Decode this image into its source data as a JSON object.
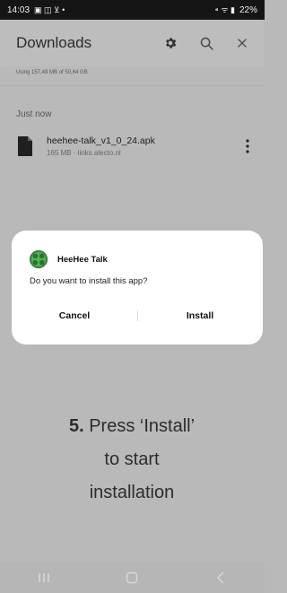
{
  "status_bar": {
    "time": "14:03",
    "left_glyphs": "▣ ◫ ⊻ •",
    "right_glyphs": "⁌ ᯤ ▮",
    "battery": "22%"
  },
  "header": {
    "title": "Downloads"
  },
  "storage": {
    "text": "Using 157,49 MB of 50,64 GB"
  },
  "downloads": {
    "section_label": "Just now",
    "item": {
      "name": "heehee-talk_v1_0_24.apk",
      "meta": "165 MB · links.alecto.nl"
    }
  },
  "dialog": {
    "app_name": "HeeHee Talk",
    "question": "Do you want to install this app?",
    "cancel_label": "Cancel",
    "install_label": "Install"
  },
  "instruction": {
    "step": "5.",
    "line1": "Press ‘Install’",
    "line2": "to start",
    "line3": "installation"
  },
  "navigation": {
    "items": [
      "recent-apps",
      "home",
      "back"
    ]
  },
  "colors": {
    "background": "#b9b9b9",
    "dialog": "#ffffff",
    "status_bar": "#151515",
    "logo_green": "#49b64d"
  }
}
